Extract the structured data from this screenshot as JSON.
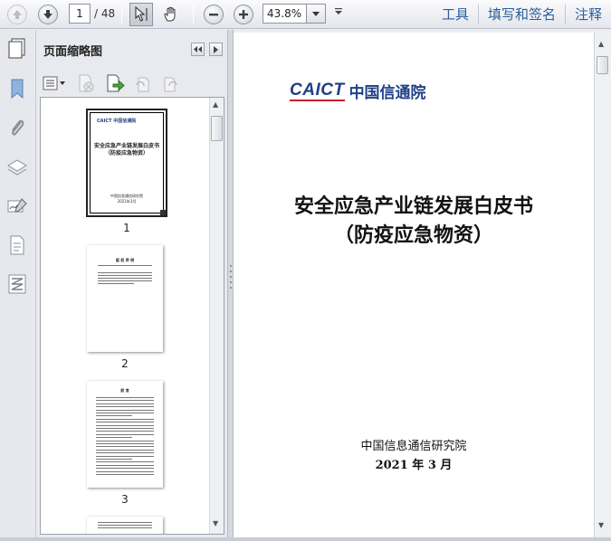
{
  "toolbar": {
    "page_current": "1",
    "page_total": "/ 48",
    "zoom": "43.8%",
    "links": [
      "工具",
      "填写和签名",
      "注释"
    ]
  },
  "panel": {
    "title": "页面缩略图",
    "thumbnails": [
      {
        "label": "1",
        "logo": "CAICT 中国信通院",
        "title": "安全应急产业链发展白皮书",
        "subtitle": "（防疫应急物资）",
        "org": "中国信息通信研究院",
        "date": "2021年3月"
      },
      {
        "label": "2",
        "heading": "版 权 声 明"
      },
      {
        "label": "3",
        "heading": "前 言"
      },
      {
        "label": ""
      }
    ]
  },
  "document": {
    "logo_en": "CAICT",
    "logo_cn": "中国信通院",
    "title_line1": "安全应急产业链发展白皮书",
    "title_line2": "（防疫应急物资）",
    "org": "中国信息通信研究院",
    "date": "2021 年 3 月"
  },
  "colors": {
    "link": "#2b5f9a",
    "logo_blue": "#1f3f86",
    "logo_red": "#c8202a"
  },
  "icons": [
    "previous-page-icon",
    "next-page-icon",
    "select-cursor-icon",
    "hand-icon",
    "zoom-out-icon",
    "zoom-in-icon",
    "pages-icon",
    "bookmark-icon",
    "attachment-icon",
    "layers-icon",
    "signature-icon",
    "page-content-icon",
    "article-icon"
  ]
}
